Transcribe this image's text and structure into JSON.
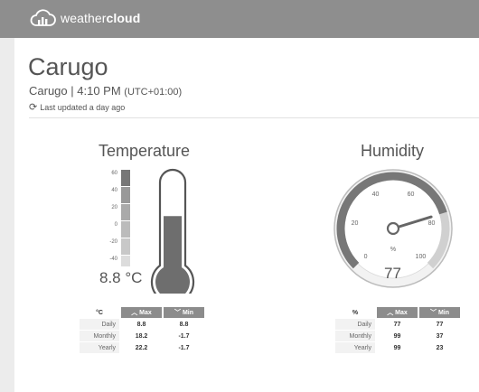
{
  "brand": {
    "prefix": "weather",
    "bold": "cloud"
  },
  "station": {
    "name": "Carugo",
    "location": "Carugo",
    "time": "4:10 PM",
    "timezone": "(UTC+01:00)",
    "updated": "Last updated a day ago"
  },
  "temperature": {
    "title": "Temperature",
    "reading": "8.8 °C",
    "level": 8.8,
    "scale": [
      "60",
      "40",
      "20",
      "0",
      "-20",
      "-40"
    ],
    "table": {
      "unit": "°C",
      "max_label": "Max",
      "min_label": "Min",
      "rows": [
        {
          "label": "Daily",
          "max": "8.8",
          "min": "8.8"
        },
        {
          "label": "Monthly",
          "max": "18.2",
          "min": "-1.7"
        },
        {
          "label": "Yearly",
          "max": "22.2",
          "min": "-1.7"
        }
      ]
    }
  },
  "humidity": {
    "title": "Humidity",
    "reading": "77",
    "unit": "%",
    "level": 77,
    "dial_labels": [
      "0",
      "20",
      "40",
      "60",
      "80",
      "100"
    ],
    "table": {
      "unit": "%",
      "max_label": "Max",
      "min_label": "Min",
      "rows": [
        {
          "label": "Daily",
          "max": "77",
          "min": "77"
        },
        {
          "label": "Monthly",
          "max": "99",
          "min": "37"
        },
        {
          "label": "Yearly",
          "max": "99",
          "min": "23"
        }
      ]
    }
  },
  "colors": {
    "topbar": "#8e8e8e",
    "gauge_dark": "#777777",
    "gauge_light": "#d0d0d0",
    "needle": "#666666"
  }
}
